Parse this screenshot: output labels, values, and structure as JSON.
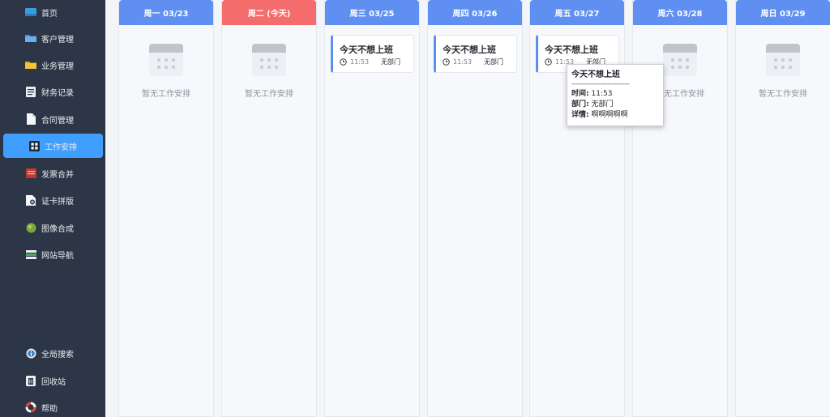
{
  "sidebar": {
    "items_top": [
      {
        "label": "首页",
        "icon": "home-icon"
      },
      {
        "label": "客户管理",
        "icon": "folder-icon"
      },
      {
        "label": "业务管理",
        "icon": "folder-icon"
      },
      {
        "label": "财务记录",
        "icon": "ledger-icon"
      },
      {
        "label": "合同管理",
        "icon": "document-icon"
      },
      {
        "label": "工作安排",
        "icon": "grid-icon",
        "active": true
      },
      {
        "label": "发票合并",
        "icon": "invoice-icon"
      },
      {
        "label": "证卡拼版",
        "icon": "id-card-icon"
      },
      {
        "label": "图像合成",
        "icon": "image-icon"
      },
      {
        "label": "网站导航",
        "icon": "navigation-icon"
      }
    ],
    "items_bottom": [
      {
        "label": "全局搜索",
        "icon": "search-icon"
      },
      {
        "label": "回收站",
        "icon": "recycle-bin-icon"
      },
      {
        "label": "帮助",
        "icon": "help-icon"
      }
    ]
  },
  "days": [
    {
      "header": "周一 03/23",
      "today": false,
      "tasks": [],
      "empty_text": "暂无工作安排"
    },
    {
      "header": "周二 (今天)",
      "today": true,
      "tasks": [],
      "empty_text": "暂无工作安排"
    },
    {
      "header": "周三 03/25",
      "today": false,
      "tasks": [
        {
          "title": "今天不想上班",
          "time": "11:53",
          "dept": "无部门"
        }
      ]
    },
    {
      "header": "周四 03/26",
      "today": false,
      "tasks": [
        {
          "title": "今天不想上班",
          "time": "11:53",
          "dept": "无部门"
        }
      ]
    },
    {
      "header": "周五 03/27",
      "today": false,
      "tasks": [
        {
          "title": "今天不想上班",
          "time": "11:53",
          "dept": "无部门"
        }
      ]
    },
    {
      "header": "周六 03/28",
      "today": false,
      "tasks": [],
      "empty_text": "暂无工作安排"
    },
    {
      "header": "周日 03/29",
      "today": false,
      "tasks": [],
      "empty_text": "暂无工作安排"
    }
  ],
  "tooltip": {
    "title": "今天不想上班",
    "separator": "--------------------------",
    "time_label": "时间:",
    "time_value": "11:53",
    "dept_label": "部门:",
    "dept_value": "无部门",
    "detail_label": "详情:",
    "detail_value": "啊啊啊啊啊"
  },
  "colors": {
    "sidebar_bg": "#2c3646",
    "active_item": "#409eff",
    "header_blue": "#5f8ff0",
    "header_today": "#f56c6c",
    "task_accent": "#5b8ef0"
  }
}
